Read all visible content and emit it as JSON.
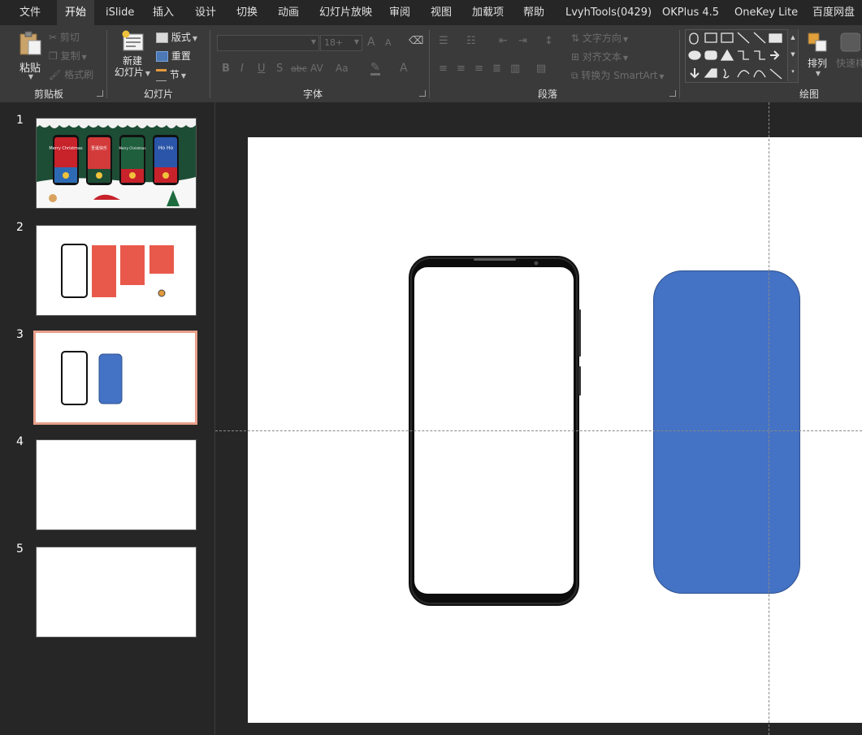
{
  "menu": {
    "tabs": [
      {
        "label": "文件"
      },
      {
        "label": "开始"
      },
      {
        "label": "iSlide"
      },
      {
        "label": "插入"
      },
      {
        "label": "设计"
      },
      {
        "label": "切换"
      },
      {
        "label": "动画"
      },
      {
        "label": "幻灯片放映"
      },
      {
        "label": "审阅"
      },
      {
        "label": "视图"
      },
      {
        "label": "加载项"
      },
      {
        "label": "帮助"
      },
      {
        "label": "LvyhTools(0429)"
      },
      {
        "label": "OKPlus 4.5"
      },
      {
        "label": "OneKey Lite"
      },
      {
        "label": "百度网盘"
      }
    ],
    "active_tab": "开始"
  },
  "ribbon": {
    "clipboard": {
      "paste": "粘贴",
      "cut": "剪切",
      "copy": "复制",
      "format_painter": "格式刷",
      "group": "剪贴板"
    },
    "slides": {
      "new_slide_line1": "新建",
      "new_slide_line2": "幻灯片",
      "layout": "版式",
      "reset": "重置",
      "section": "节",
      "group": "幻灯片"
    },
    "font": {
      "size": "18+",
      "bold": "B",
      "italic": "I",
      "underline": "U",
      "shadow": "S",
      "strike": "abc",
      "spacing": "AV",
      "case": "Aa",
      "grow": "A",
      "shrink": "A",
      "color": "A",
      "group": "字体"
    },
    "paragraph": {
      "text_direction": "文字方向",
      "align_text": "对齐文本",
      "convert_smartart": "转换为 SmartArt",
      "group": "段落"
    },
    "drawing": {
      "arrange": "排列",
      "quick_styles": "快速样",
      "group": "绘图"
    }
  },
  "thumbnails": [
    {
      "number": "1"
    },
    {
      "number": "2"
    },
    {
      "number": "3"
    },
    {
      "number": "4"
    },
    {
      "number": "5"
    }
  ],
  "selected_slide": "3",
  "thumb1_texts": {
    "card1": "Merry Christmas",
    "card2": "圣诞快乐",
    "card3": "Merry Christmas",
    "card4": "Ho Ho"
  },
  "colors": {
    "app_bg": "#262626",
    "ribbon_bg": "#3a3a3a",
    "selected_border": "#e8a08b",
    "blue_shape": "#4472c4",
    "red_shape": "#e8594b",
    "xmas_green": "#1e4d36"
  }
}
